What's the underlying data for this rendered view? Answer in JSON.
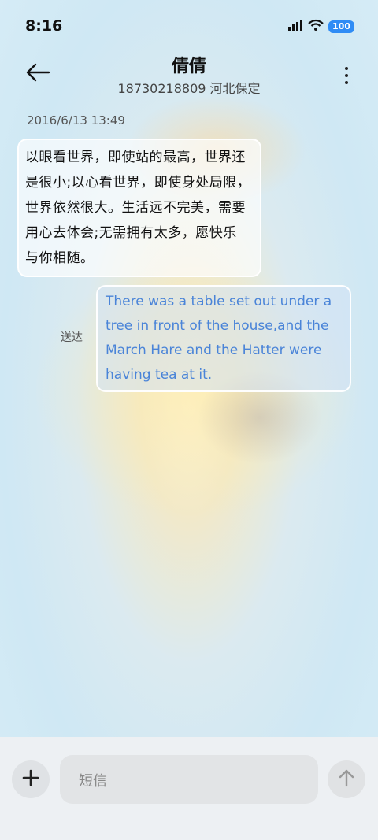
{
  "status_bar": {
    "time": "8:16",
    "battery": "100",
    "icons": [
      "signal-icon",
      "wifi-icon",
      "battery-icon"
    ]
  },
  "header": {
    "title": "倩倩",
    "subtitle": "18730218809 河北保定",
    "back_icon": "back-arrow-icon",
    "more_icon": "more-vertical-icon"
  },
  "conversation": {
    "timestamp": "2016/6/13 13:49",
    "incoming": {
      "lines": [
        "以眼看世界，即使站的最高，世界还",
        "是很小;以心看世界，即使身处局限，",
        "世界依然很大。生活远不完美，需要",
        "用心去体会;无需拥有太多，愿快乐",
        "与你相随。"
      ]
    },
    "outgoing": {
      "lines": [
        "There was a table set out under a",
        "tree in front of the house,and the",
        "March Hare and the Hatter were",
        "having tea at it."
      ],
      "status": "送达"
    }
  },
  "composer": {
    "placeholder": "短信",
    "add_icon": "plus-icon",
    "send_icon": "send-arrow-icon"
  },
  "colors": {
    "outgoing_text": "#4a84d8",
    "battery": "#2f8cf5"
  }
}
